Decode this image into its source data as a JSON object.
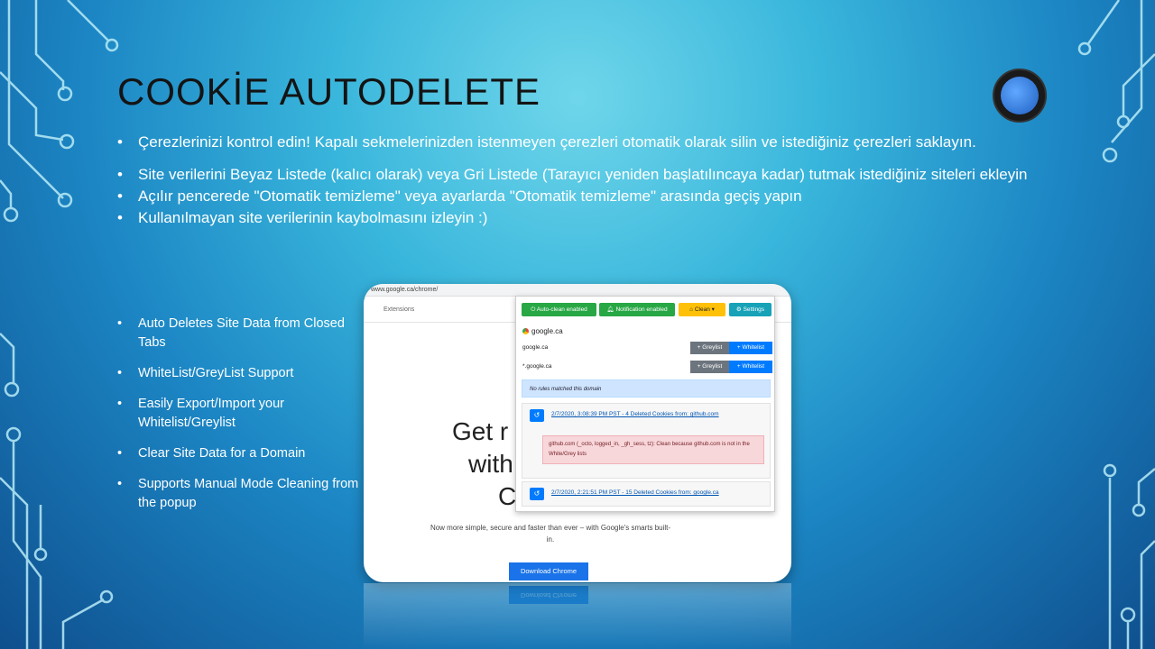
{
  "slide": {
    "title": "COOKİE AUTODELETE",
    "bullets": [
      "Çerezlerinizi kontrol edin! Kapalı sekmelerinizden istenmeyen çerezleri otomatik olarak silin ve istediğiniz çerezleri saklayın.",
      "Site verilerini Beyaz Listede (kalıcı olarak) veya Gri Listede (Tarayıcı yeniden başlatılıncaya kadar) tutmak istediğiniz siteleri ekleyin",
      "Açılır pencerede \"Otomatik temizleme\" veya ayarlarda \"Otomatik temizleme\" arasında geçiş yapın",
      "Kullanılmayan site verilerinin kaybolmasını izleyin :)"
    ],
    "features": [
      "Auto Deletes Site Data from Closed Tabs",
      "WhiteList/GreyList Support",
      "Easily Export/Import your Whitelist/Greylist",
      "Clear Site Data for a Domain",
      "Supports Manual Mode Cleaning from the popup"
    ]
  },
  "screenshot": {
    "url": "www.google.ca/chrome/",
    "extensions_label": "Extensions",
    "hero_line1": "Get r",
    "hero_line2": "with",
    "hero_line3": "C",
    "tagline": "Now more simple, secure and faster than ever – with Google's smarts built-in.",
    "download_button": "Download Chrome",
    "popup": {
      "autoclean_button": "Auto-clean enabled",
      "notification_button": "Notification enabled",
      "clean_button": "Clean",
      "settings_button": "Settings",
      "domain": "google.ca",
      "rows": [
        {
          "domain": "google.ca",
          "grey": "Greylist",
          "white": "Whitelist"
        },
        {
          "domain": "*.google.ca",
          "grey": "Greylist",
          "white": "Whitelist"
        }
      ],
      "no_rules": "No rules matched this domain",
      "log1": "2/7/2020, 3:08:39 PM PST - 4 Deleted Cookies from: github.com",
      "log1_detail": "github.com (_octo, logged_in, _gh_sess, tz): Clean because github.com is not in the White/Grey lists",
      "log2": "2/7/2020, 2:21:51 PM PST - 15 Deleted Cookies from: google.ca"
    }
  },
  "colors": {
    "accent_green": "#28a745",
    "accent_blue": "#007bff",
    "accent_yellow": "#ffc107",
    "accent_teal": "#17a2b8"
  }
}
